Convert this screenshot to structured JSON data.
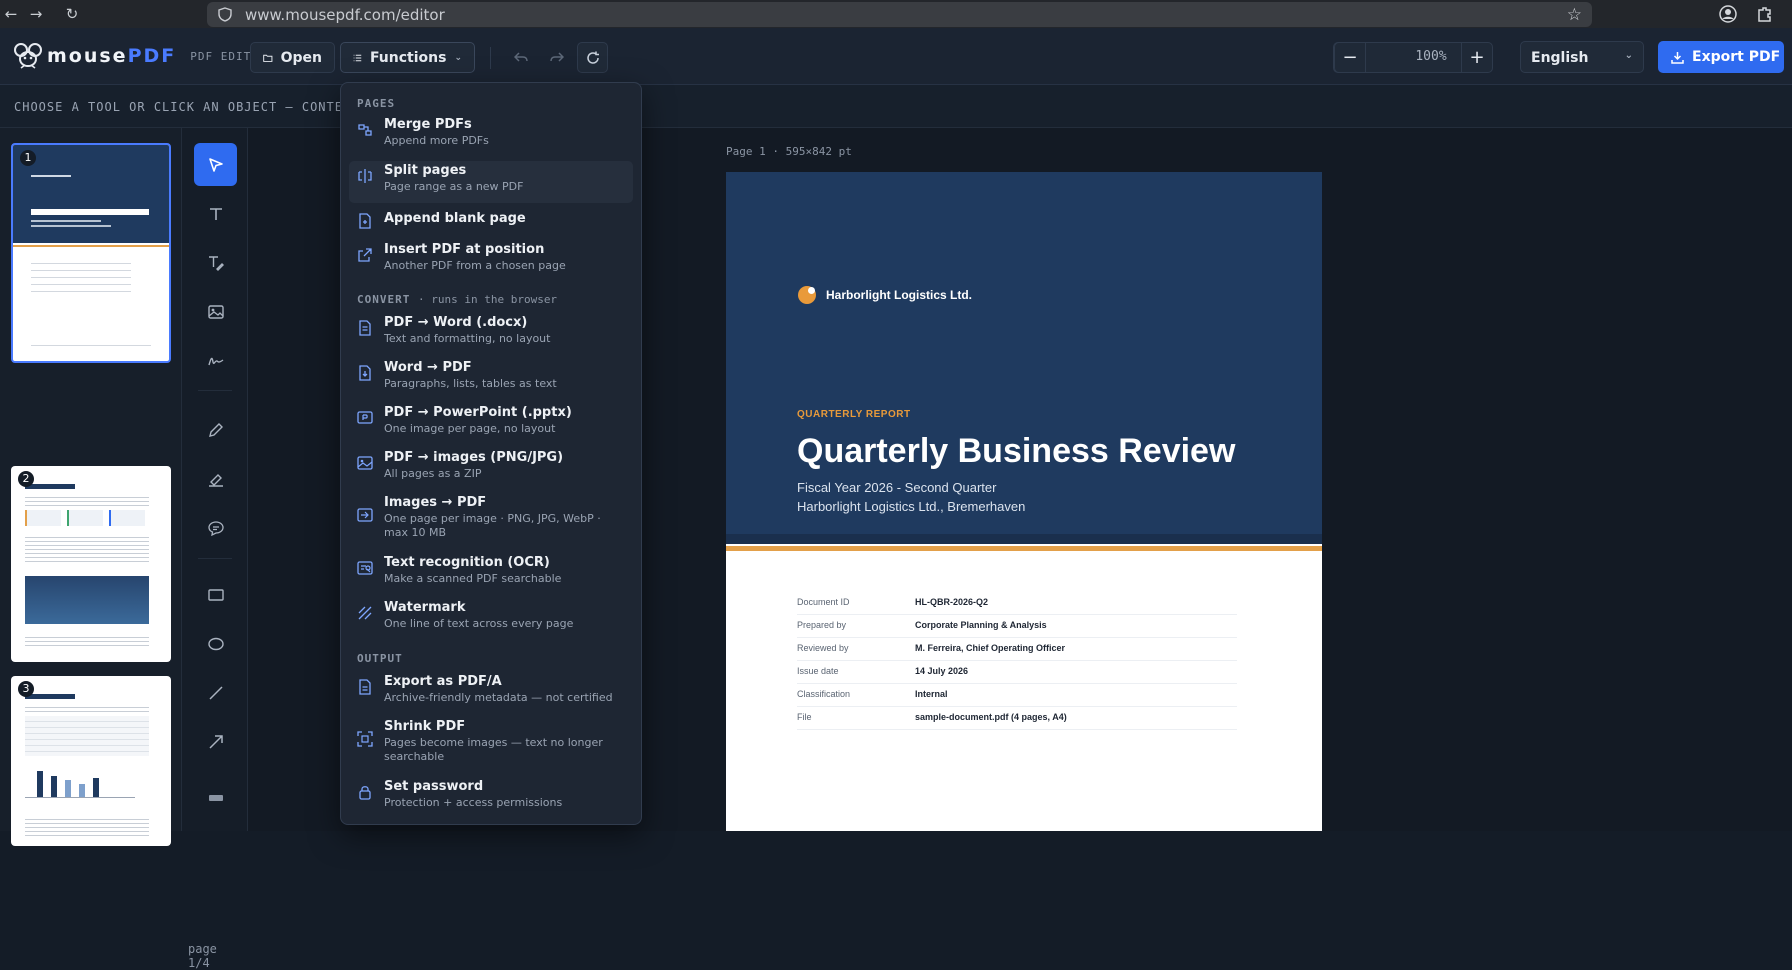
{
  "browser": {
    "url": "www.mousepdf.com/editor"
  },
  "app": {
    "brand_a": "mouse",
    "brand_b": "PDF",
    "subtitle": "PDF EDITOR"
  },
  "toolbar": {
    "open_label": "Open",
    "functions_label": "Functions",
    "zoom": "100%",
    "language": "English",
    "export_label": "Export PDF"
  },
  "hint": "CHOOSE A TOOL OR CLICK AN OBJECT — CONTEXT-S",
  "thumbs": {
    "n1": "1",
    "n2": "2",
    "n3": "3",
    "page_label": "page 1/4"
  },
  "page_info": "Page 1 · 595×842 pt",
  "document": {
    "company": "Harborlight Logistics Ltd.",
    "kicker": "QUARTERLY REPORT",
    "title": "Quarterly Business Review",
    "subtitle1": "Fiscal Year 2026 - Second Quarter",
    "subtitle2": "Harborlight Logistics Ltd., Bremerhaven",
    "meta": [
      {
        "k": "Document ID",
        "v": "HL-QBR-2026-Q2"
      },
      {
        "k": "Prepared by",
        "v": "Corporate Planning & Analysis"
      },
      {
        "k": "Reviewed by",
        "v": "M. Ferreira, Chief Operating Officer"
      },
      {
        "k": "Issue date",
        "v": "14 July 2026"
      },
      {
        "k": "Classification",
        "v": "Internal"
      },
      {
        "k": "File",
        "v": "sample-document.pdf (4 pages, A4)"
      }
    ]
  },
  "menu": {
    "sec_pages": "PAGES",
    "sec_convert": "CONVERT",
    "sec_convert_note": "· runs in the browser",
    "sec_output": "OUTPUT",
    "items": [
      {
        "t": "Merge PDFs",
        "d": "Append more PDFs"
      },
      {
        "t": "Split pages",
        "d": "Page range as a new PDF"
      },
      {
        "t": "Append blank page",
        "d": ""
      },
      {
        "t": "Insert PDF at position",
        "d": "Another PDF from a chosen page"
      },
      {
        "t": "PDF → Word (.docx)",
        "d": "Text and formatting, no layout"
      },
      {
        "t": "Word → PDF",
        "d": "Paragraphs, lists, tables as text"
      },
      {
        "t": "PDF → PowerPoint (.pptx)",
        "d": "One image per page, no layout"
      },
      {
        "t": "PDF → images (PNG/JPG)",
        "d": "All pages as a ZIP"
      },
      {
        "t": "Images → PDF",
        "d": "One page per image · PNG, JPG, WebP · max 10 MB"
      },
      {
        "t": "Text recognition (OCR)",
        "d": "Make a scanned PDF searchable"
      },
      {
        "t": "Watermark",
        "d": "One line of text across every page"
      },
      {
        "t": "Export as PDF/A",
        "d": "Archive-friendly metadata — not certified"
      },
      {
        "t": "Shrink PDF",
        "d": "Pages become images — text no longer searchable"
      },
      {
        "t": "Set password",
        "d": "Protection + access permissions"
      }
    ]
  },
  "colors": {
    "accent": "#2f6bf0",
    "orange": "#e3a04a",
    "navy": "#1f3a5f"
  }
}
